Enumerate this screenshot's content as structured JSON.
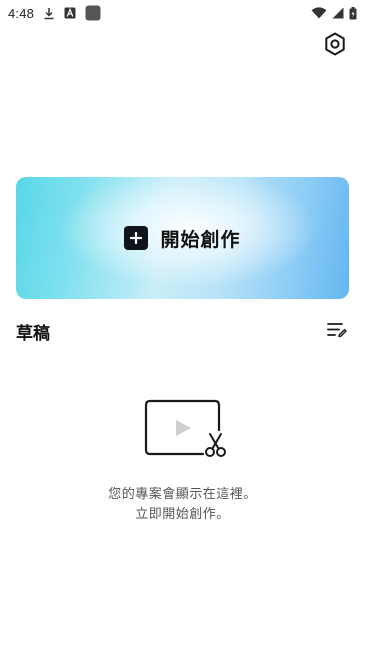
{
  "status_bar": {
    "time": "4:48",
    "icons_left": [
      "download-icon",
      "a-badge-icon",
      "app-square-icon"
    ],
    "icons_right": [
      "wifi-icon",
      "signal-icon",
      "battery-icon"
    ]
  },
  "header": {
    "settings_icon": "settings-hexagon-icon"
  },
  "create_card": {
    "label": "開始創作",
    "icon": "plus-square-icon",
    "gradient_colors": [
      "#57d7e8",
      "#c8eef7",
      "#62b6f2"
    ]
  },
  "drafts": {
    "title": "草稿",
    "edit_icon": "edit-list-icon"
  },
  "empty_state": {
    "illustration": "video-scissors-icon",
    "line1": "您的專案會顯示在這裡。",
    "line2": "立即開始創作。"
  }
}
